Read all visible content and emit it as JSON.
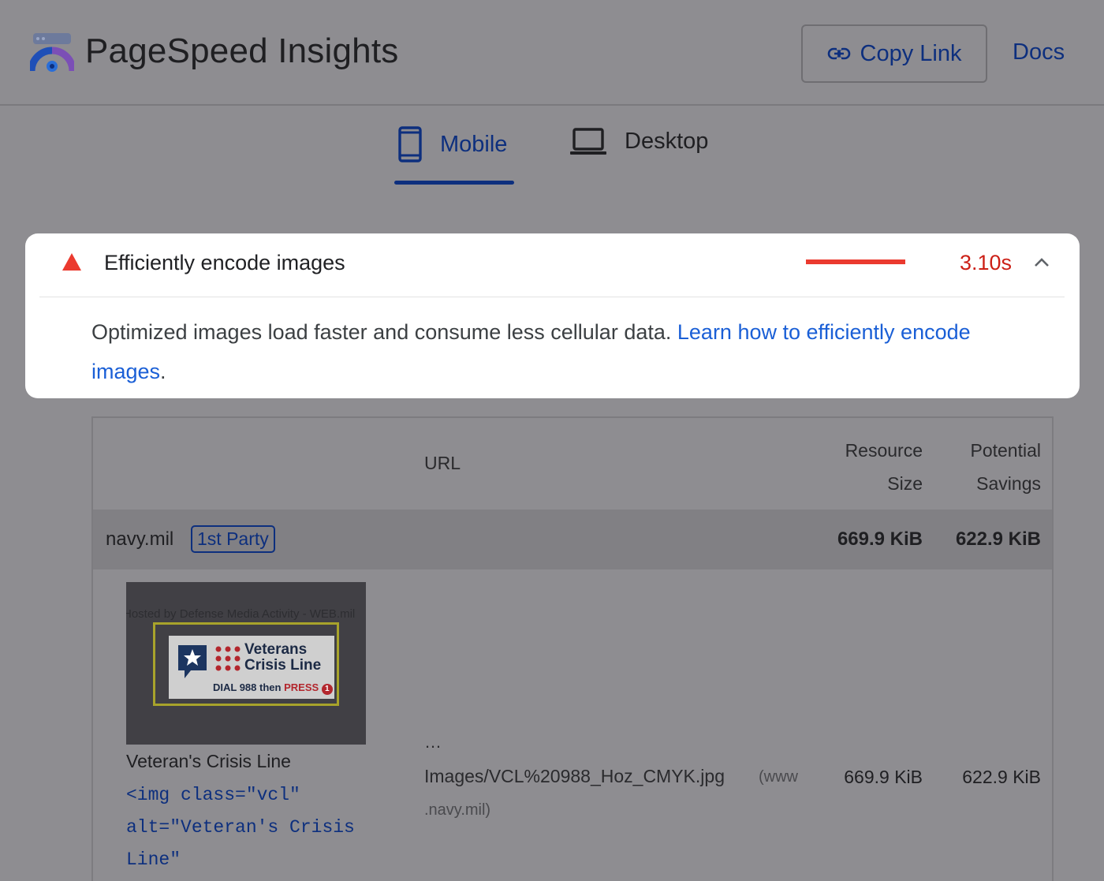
{
  "header": {
    "app_title": "PageSpeed Insights",
    "copy_link_label": "Copy Link",
    "docs_label": "Docs",
    "logo_icon": "pagespeed-gauge-icon"
  },
  "tabs": [
    {
      "label": "Mobile",
      "icon": "mobile-phone-icon",
      "selected": true
    },
    {
      "label": "Desktop",
      "icon": "laptop-icon",
      "selected": false
    }
  ],
  "audit": {
    "title": "Efficiently encode images",
    "value": "3.10s",
    "status": "fail",
    "status_color": "#eb3a2f",
    "expanded": true,
    "description": "Optimized images load faster and consume less cellular data.",
    "learn_more_label": "Learn how to efficiently encode images",
    "trailing_punct": "."
  },
  "table": {
    "headers": {
      "url": "URL",
      "resource_size": [
        "Resource",
        "Size"
      ],
      "potential_savings": [
        "Potential",
        "Savings"
      ]
    },
    "groups": [
      {
        "entity": "navy.mil",
        "badge": "1st Party",
        "resource_size": "669.9 KiB",
        "potential_savings": "622.9 KiB",
        "items": [
          {
            "thumbnail": {
              "caption": "Hosted by Defense Media Activity - WEB.mil",
              "logo_title_line1": "Veterans",
              "logo_title_line2": "Crisis Line",
              "logo_dial": "DIAL 988",
              "logo_then": "then",
              "logo_press": "PRESS",
              "logo_press_num": "1"
            },
            "node_label": "Veteran's Crisis Line",
            "node_snippet": "<img class=\"vcl\"\nalt=\"Veteran's Crisis\nLine\"",
            "url_ellipsis": "…",
            "url_path": "Images/VCL%20988_Hoz_CMYK.jpg",
            "url_host_line1": "(www",
            "url_host_line2": ".navy.mil)",
            "resource_size": "669.9 KiB",
            "potential_savings": "622.9 KiB"
          }
        ]
      }
    ]
  }
}
